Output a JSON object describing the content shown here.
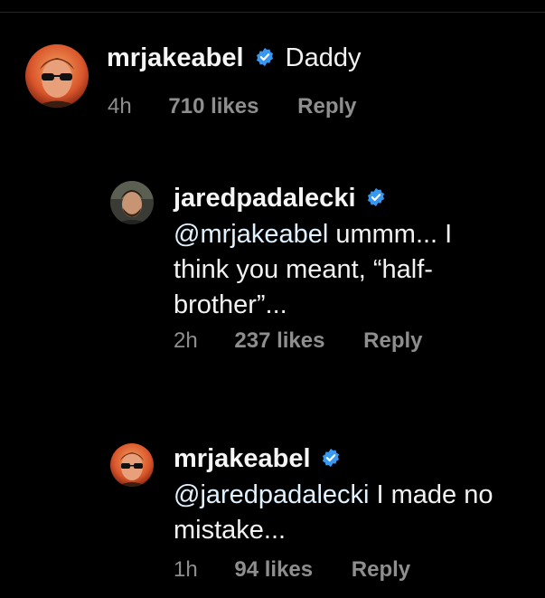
{
  "comments": [
    {
      "username": "mrjakeabel",
      "text": "Daddy",
      "time": "4h",
      "likes": "710 likes",
      "reply_label": "Reply"
    },
    {
      "username": "jaredpadalecki",
      "mention": "@mrjakeabel",
      "text_line1": " ummm... I",
      "text_line2": "think you meant, “half-",
      "text_line3": "brother”...",
      "time": "2h",
      "likes": "237 likes",
      "reply_label": "Reply"
    },
    {
      "username": "mrjakeabel",
      "mention": "@jaredpadalecki",
      "text_line1": " I made no",
      "text_line2": "mistake...",
      "time": "1h",
      "likes": "94 likes",
      "reply_label": "Reply"
    }
  ],
  "colors": {
    "background": "#000000",
    "verified": "#3897f0",
    "meta": "#8e8e8e"
  },
  "icons": {
    "verified": "verified-badge-icon"
  }
}
